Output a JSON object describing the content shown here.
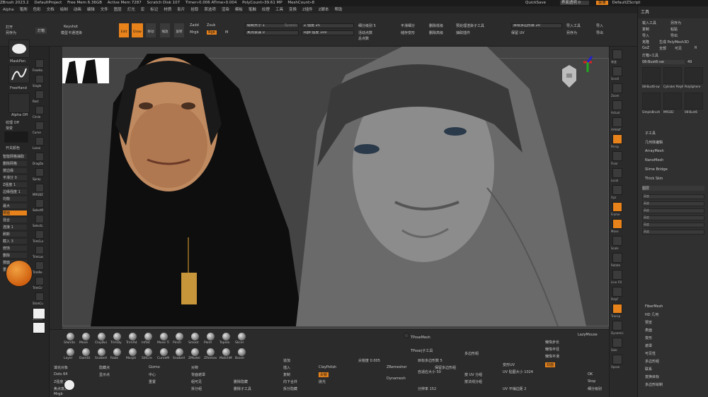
{
  "titlebar": {
    "app": "ZBrush 2023.2",
    "project": "DefaultProject",
    "free_mem": "Free Mem 6.36GB",
    "active_mem": "Active Mem 7287",
    "scratch": "Scratch Disk 107",
    "timer": "Timer»0.006 ATime»0.004",
    "polycount": "PolyCount»39.61 MP",
    "meshcount": "MeshCount»8",
    "quicksave": "QuickSave",
    "transparency": "界面透明 0",
    "menus_btn": "菜单",
    "script": "DefaultZScript"
  },
  "menubar": [
    "Alpha",
    "笔刷",
    "色彩",
    "文档",
    "绘制",
    "动画",
    "编辑",
    "文件",
    "图层",
    "灯光",
    "宏",
    "标记",
    "材质",
    "影片",
    "拾取",
    "首选项",
    "渲染",
    "模板",
    "笔触",
    "纹理",
    "工具",
    "变换",
    "Z插件",
    "Z脚本",
    "帮助"
  ],
  "topshelf": {
    "open": "打开",
    "saveas": "另存为",
    "lightbox": "灯箱",
    "keyshot": "Keyshot",
    "keyshot_sub": "模型卡通渲染",
    "edit": "Edit",
    "draw": "Draw",
    "move": "移动",
    "scale": "缩放",
    "rotate": "旋转",
    "mrgb": "Mrgb",
    "rgb": "Rgb",
    "m": "M",
    "zadd": "Zadd",
    "zsub": "Zsub",
    "rgb_intensity": "Rgb 强度 100",
    "z_intensity": "Z 强度 25",
    "focal_shift": "焦点衰减 0",
    "draw_size": "绘制大小 1",
    "dynamic": "Dynamic",
    "active_points": "活动点数",
    "total_points": "总点数",
    "subdivision": "细分级别 5",
    "smooth_sub": "平滑细分",
    "del_lower": "删除低级",
    "del_higher": "删除高级",
    "store_morph": "储存变形",
    "project_all": "投射所有",
    "sub_tool_label": "预处理渲染子工具",
    "point_count": "目标多边形数 20",
    "keep_uv": "保留 UV",
    "zremesh_label": "抽取插件",
    "import": "导入工具",
    "export": "导出",
    "saveas2": "另存为",
    "import2": "导入"
  },
  "lefttray": {
    "alpha_label": "MaskPen",
    "stroke_label": "FreeHand",
    "alpha_off": "Alpha Off",
    "texture_off": "纹理 Off",
    "gradient": "渐变",
    "brush_tools": [
      "FreeHa",
      "Single",
      "Rect",
      "Circle",
      "Curve",
      "Lasso",
      "DragDo",
      "Spray",
      "MRGBZ",
      "SelectR",
      "SelectL",
      "TrimCur",
      "TrimLas",
      "TrimRe",
      "TrimCir",
      "SliceCu",
      "SliceRe"
    ],
    "rows": [
      "智能网格抽取",
      "删除网格",
      "按边缘",
      "平滑分 0",
      "Z强度 1",
      "边缘强度 1",
      "均衡",
      "最大",
      "按面",
      "混合",
      "连接 1",
      "刷新",
      "截入 3",
      "修饰",
      "删除",
      "按面",
      "重置"
    ],
    "swatch_label": "开关颜色"
  },
  "canvas": {
    "bg": "#444444"
  },
  "righttray1": {
    "items": [
      "渐变",
      "Scroll",
      "Zoom",
      "Actual",
      "AAHalf",
      "Persp",
      "Floor",
      "Local",
      "Xyz",
      "Frame",
      "Move",
      "Scale",
      "Rotate",
      "Line Fill",
      "PolyF",
      "Transp",
      "Dynamic",
      "Solo",
      "Xpose"
    ]
  },
  "toolpanel": {
    "title": "工具",
    "load": "载入工具",
    "saveas": "另存为",
    "copy": "复制",
    "paste": "粘贴",
    "import": "导入",
    "export": "导出",
    "clone": "克隆",
    "make_polymesh": "生成 PolyMesh3D",
    "goz": "GoZ",
    "all": "全部",
    "visible": "可见",
    "r": "R",
    "lightbox": "灯箱»工具",
    "tool_name": "08-Bust6-sw",
    "tool_count": "49",
    "thumbs": [
      "08-Bust6-sw",
      "Cylinder PolyMe",
      "PolySphere",
      "SimpleBrush",
      "MRGB2",
      "08-Bust6"
    ],
    "subtools": [
      "子工具",
      "几何体编辑",
      "ArrayMesh",
      "NanoMesh",
      "Slime Bridge",
      "Thick Skin"
    ],
    "layers_head": "图层",
    "sliders": [
      "高度",
      "高度",
      "高度",
      "高度",
      "高度",
      "高度"
    ],
    "bottom_items": [
      "FiberMesh",
      "HD 几何",
      "预览",
      "表面",
      "变形",
      "遮罩",
      "可见性",
      "多边形组",
      "联系",
      "变换目标",
      "多边形绘制"
    ]
  },
  "bottomshelf": {
    "brushes": [
      "Standa",
      "Move",
      "ClayBui",
      "TrimDy",
      "TrimAd",
      "Inflat",
      "Move Ti",
      "Pinch",
      "Smoot",
      "Paint",
      "Topolo",
      "Slicer",
      "Layer",
      "DamSt",
      "SnakeH",
      "Rake",
      "Morph",
      "SlitCre",
      "CurveM",
      "SnakeH",
      "ZModel",
      "ZRemes",
      "MatchM",
      "Boom"
    ],
    "controls": {
      "fill_sub": "填充对象",
      "dots": "Dots 64",
      "zdepth": "Z强度 25",
      "focal": "焦点衰减 0",
      "mrgb": "Mrgb",
      "rgb": "Rgb",
      "hide_pt": "隐藏点",
      "show_pt": "显示点",
      "gizmo": "Gizmo",
      "center": "中心",
      "reset": "重置",
      "symmetry": "对称",
      "backface": "背面遮罩",
      "clay_polish": "ClayPolish",
      "sharp": "尖锐",
      "sharpness": "尖锐度 0.005",
      "polish": "抛光",
      "zremesher": "ZRemesher",
      "dynamesh": "Dynamesh",
      "resolution": "分辨率 152",
      "target_polys": "目标多边形数 5",
      "adapt": "自适应大小 50",
      "keep_groups": "保留多边形组",
      "uv_map": "UV 贴图大小 1024",
      "morph_uv": "变形UV",
      "uv_tiles": "UV 平铺边距 2",
      "tpose_mesh": "TPoseMesh",
      "tpose_sub": "TPose|子工具",
      "lazy_mouse": "LazyMouse",
      "lazy_step": "懒惰步长",
      "lazy_radius": "懒惰半径",
      "lazy_smooth": "懒惰平滑",
      "double": "双面",
      "group_visible": "组可见",
      "group_split": "拆分组",
      "delete_hidden": "删除隐藏",
      "del_sub": "删除子工具",
      "append": "追加",
      "insert": "插入",
      "duplicate": "复制",
      "merge_down": "向下合并",
      "split_hidden": "拆分隐藏",
      "polygroup": "多边形组",
      "polygroups_by_uv": "按 UV 分组",
      "group_normals": "按法线分组",
      "ok": "OK",
      "stop": "Stop",
      "sdiv": "细分级别"
    }
  }
}
